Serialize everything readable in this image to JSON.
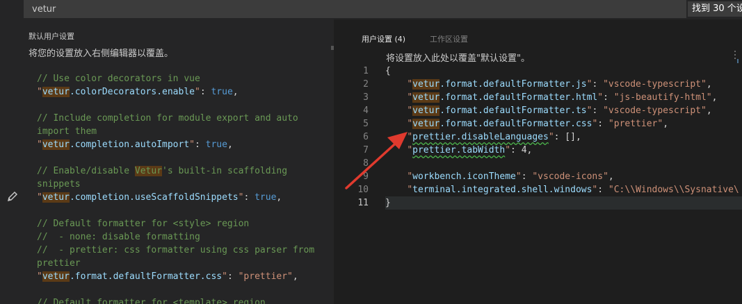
{
  "search": {
    "value": "vetur",
    "results_label": "找到 30 个设"
  },
  "left": {
    "title": "默认用户设置",
    "description": "将您的设置放入右侧编辑器以覆盖。",
    "lines": [
      {
        "comment": "// Use color decorators in vue"
      },
      {
        "key_hl": "vetur",
        "key_rest": ".colorDecorators.enable",
        "value": "true",
        "vtype": "bool"
      },
      {
        "blank": true
      },
      {
        "comment": "// Include completion for module export and auto"
      },
      {
        "comment": "import them"
      },
      {
        "key_hl": "vetur",
        "key_rest": ".completion.autoImport",
        "value": "true",
        "vtype": "bool"
      },
      {
        "blank": true
      },
      {
        "comment_pre": "// Enable/disable ",
        "comment_hl": "Vetur",
        "comment_post": "'s built-in scaffolding"
      },
      {
        "comment": "snippets"
      },
      {
        "key_hl": "vetur",
        "key_rest": ".completion.useScaffoldSnippets",
        "value": "true",
        "vtype": "bool"
      },
      {
        "blank": true
      },
      {
        "comment": "// Default formatter for <style> region"
      },
      {
        "comment": "//  - none: disable formatting"
      },
      {
        "comment": "//  - prettier: css formatter using css parser from"
      },
      {
        "comment": "prettier"
      },
      {
        "key_hl": "vetur",
        "key_rest": ".format.defaultFormatter.css",
        "value": "\"prettier\"",
        "vtype": "str"
      },
      {
        "blank": true
      },
      {
        "comment": "// Default formatter for <template> region"
      }
    ]
  },
  "right": {
    "tabs": {
      "user": "用户设置 (4)",
      "workspace": "工作区设置"
    },
    "description": "将设置放入此处以覆盖\"默认设置\"。",
    "line_numbers": [
      "1",
      "2",
      "3",
      "4",
      "5",
      "6",
      "7",
      "8",
      "9",
      "10",
      "11"
    ],
    "lines": [
      {
        "text": "{"
      },
      {
        "key_hl": "vetur",
        "key_rest": ".format.defaultFormatter.js",
        "value": "\"vscode-typescript\"",
        "trail": ","
      },
      {
        "key_hl": "vetur",
        "key_rest": ".format.defaultFormatter.html",
        "value": "\"js-beautify-html\"",
        "trail": ","
      },
      {
        "key_hl": "vetur",
        "key_rest": ".format.defaultFormatter.ts",
        "value": "\"vscode-typescript\"",
        "trail": ","
      },
      {
        "key_hl": "vetur",
        "key_rest": ".format.defaultFormatter.css",
        "value": "\"prettier\"",
        "trail": ","
      },
      {
        "key": "prettier.disableLanguages",
        "value": "[]",
        "vtype": "punc",
        "trail": ",",
        "squiggle": true
      },
      {
        "key": "prettier.tabWidth",
        "value": "4",
        "vtype": "num",
        "trail": ",",
        "squiggle": true
      },
      {
        "blank": true
      },
      {
        "key": "workbench.iconTheme",
        "value": "\"vscode-icons\"",
        "trail": ","
      },
      {
        "key": "terminal.integrated.shell.windows",
        "value": "\"C:\\\\Windows\\\\Sysnative\\"
      },
      {
        "text": "}"
      }
    ]
  },
  "colors": {
    "comment": "#6a9955",
    "string": "#ce9178",
    "key": "#9cdcfe",
    "keyword": "#569cd6",
    "match_highlight": "#5b3a16",
    "annotation_arrow": "#e03a2e"
  },
  "icons": {
    "edit": "pencil-icon"
  }
}
